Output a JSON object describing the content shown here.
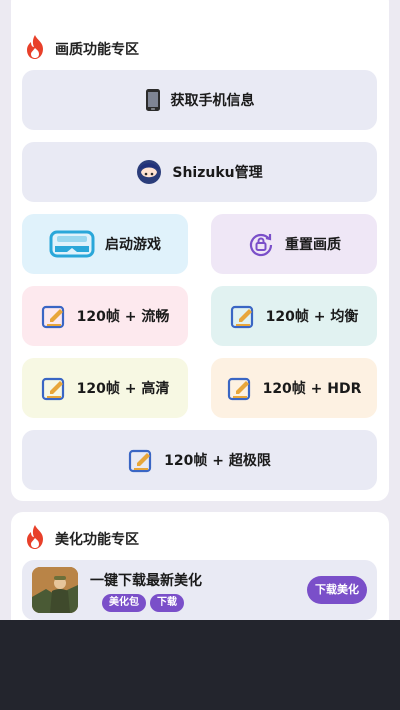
{
  "sections": {
    "quality": {
      "title": "画质功能专区",
      "icon": "flame-icon"
    },
    "beauty": {
      "title": "美化功能专区",
      "icon": "flame-icon"
    }
  },
  "buttons": {
    "phone_info": "获取手机信息",
    "shizuku": "Shizuku管理",
    "launch_game": "启动游戏",
    "reset_quality": "重置画质",
    "fps_smooth": "120帧 + 流畅",
    "fps_balanced": "120帧 + 均衡",
    "fps_hd": "120帧 + 高清",
    "fps_hdr": "120帧 + HDR",
    "fps_ultra": "120帧 + 超极限"
  },
  "beauty_item": {
    "title": "一键下载最新美化",
    "tags": [
      "美化包",
      "下载"
    ],
    "download_label": "下载美化"
  },
  "colors": {
    "accent": "#7a4fc9",
    "flame": "#e8402a",
    "tile_blue": "#e0f2fb",
    "tile_purple": "#efe7f6",
    "tile_pink": "#fde9ee",
    "tile_teal": "#e1f2f1",
    "tile_yellow": "#f7f8e3",
    "tile_orange": "#fdf1e2",
    "tile_gray": "#e9eaf4"
  }
}
